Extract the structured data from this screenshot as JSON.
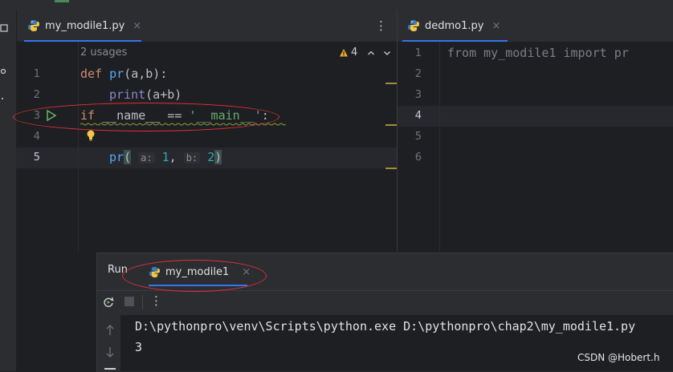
{
  "left_editor": {
    "tab": {
      "label": "my_modile1.py",
      "close": "×"
    },
    "usages": "2 usages",
    "warning_count": "4",
    "gutter": [
      "1",
      "2",
      "3",
      "4",
      "5"
    ],
    "code": {
      "l1": {
        "kw": "def",
        "name": "pr",
        "rest": "(a,b):"
      },
      "l2": {
        "builtin": "print",
        "rest": "(a+b)"
      },
      "l3": {
        "kw": "if",
        "rest1": " __name__ == ",
        "str": "'__main__'",
        "rest2": ":"
      },
      "l5": {
        "name": "pr",
        "open": "(",
        "hint_a": "a:",
        "arg_a": "1",
        "comma": ",",
        "hint_b": "b:",
        "arg_b": "2",
        "close": ")"
      }
    }
  },
  "right_editor": {
    "tab": {
      "label": "dedmo1.py",
      "close": "×"
    },
    "gutter": [
      "1",
      "2",
      "3",
      "4",
      "5",
      "6"
    ],
    "code_line1": "from my_modile1 import pr"
  },
  "run_panel": {
    "title": "Run",
    "tab": {
      "label": "my_modile1",
      "close": "×"
    },
    "console": [
      "D:\\pythonpro\\venv\\Scripts\\python.exe D:\\pythonpro\\chap2\\my_modile1.py",
      "3"
    ]
  },
  "watermark": "CSDN @Hobert.h",
  "colors": {
    "accent": "#3574f0",
    "annotation": "#e0303a",
    "run_green": "#5fb865"
  },
  "icons": [
    "python-file-icon",
    "run-gutter-icon",
    "lightbulb-icon",
    "rerun-icon",
    "stop-icon",
    "more-icon",
    "warning-icon",
    "arrow-up-icon",
    "arrow-down-icon"
  ]
}
